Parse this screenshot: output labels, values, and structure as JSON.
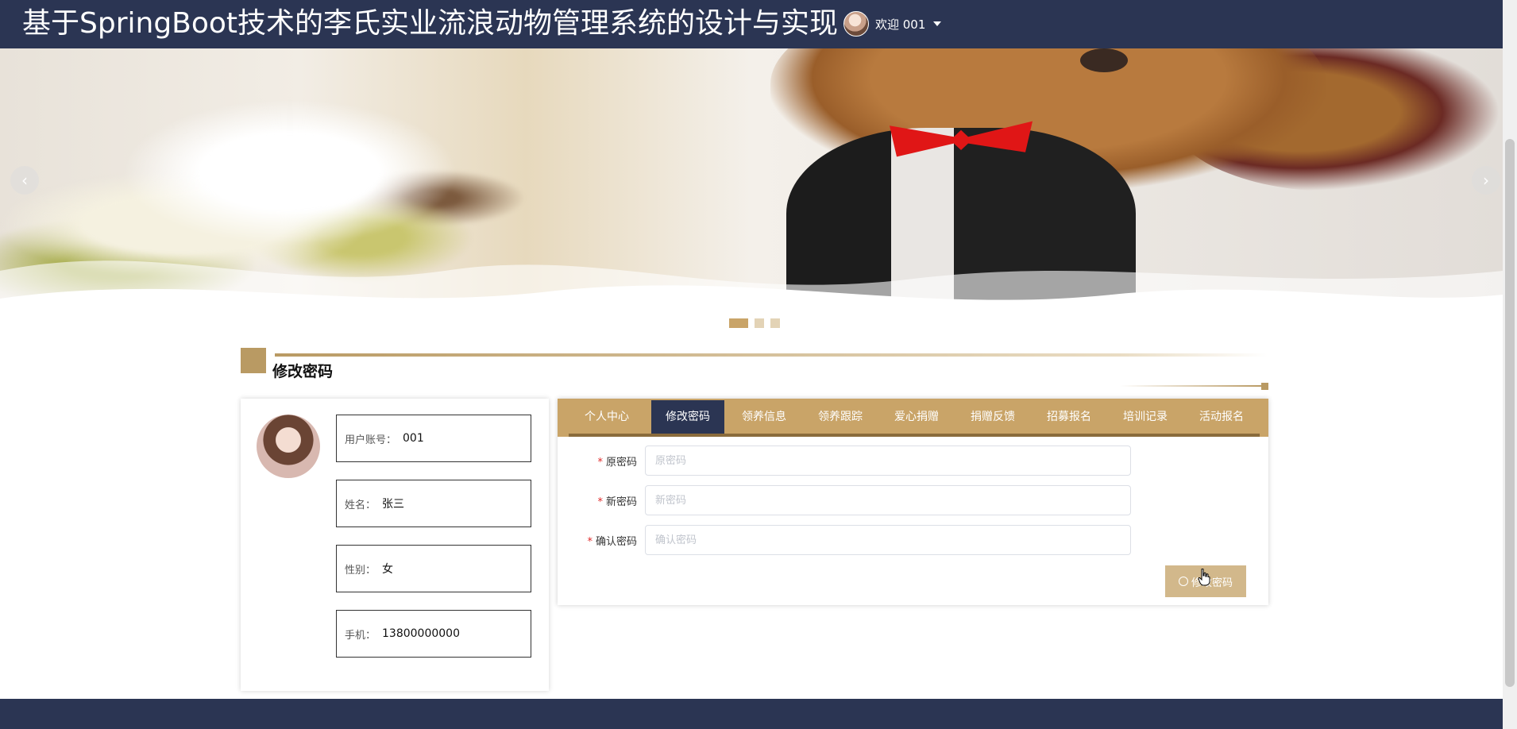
{
  "header": {
    "site_title": "基于SpringBoot技术的李氏实业流浪动物管理系统的设计与实现",
    "welcome_text": "欢迎 001"
  },
  "carousel": {
    "prev_label": "‹",
    "next_label": "›",
    "slide_count": 3,
    "active_slide": 1
  },
  "section": {
    "title": "修改密码"
  },
  "profile": {
    "fields": [
      {
        "label": "用户账号：",
        "value": "001"
      },
      {
        "label": "姓名：",
        "value": "张三"
      },
      {
        "label": "性别：",
        "value": "女"
      },
      {
        "label": "手机：",
        "value": "13800000000"
      }
    ]
  },
  "tabs": [
    {
      "label": "个人中心"
    },
    {
      "label": "修改密码"
    },
    {
      "label": "领养信息"
    },
    {
      "label": "领养跟踪"
    },
    {
      "label": "爱心捐赠"
    },
    {
      "label": "捐赠反馈"
    },
    {
      "label": "招募报名"
    },
    {
      "label": "培训记录"
    },
    {
      "label": "活动报名"
    }
  ],
  "active_tab": "修改密码",
  "form": {
    "fields": [
      {
        "label": "原密码",
        "placeholder": "原密码",
        "value": ""
      },
      {
        "label": "新密码",
        "placeholder": "新密码",
        "value": ""
      },
      {
        "label": "确认密码",
        "placeholder": "确认密码",
        "value": ""
      }
    ],
    "submit_label": "修改密码"
  },
  "colors": {
    "header_bg": "#2b3553",
    "accent_gold": "#c9a468",
    "button_bg": "#d2b88b",
    "required_star": "#e02a2a"
  }
}
